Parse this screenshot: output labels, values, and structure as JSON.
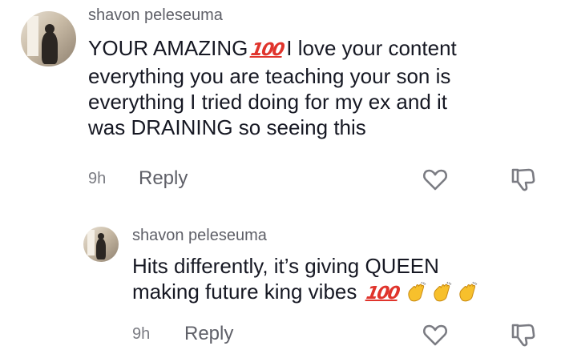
{
  "comment": {
    "username": "shavon peleseuma",
    "lines": [
      "YOUR AMAZING",
      "I love your content",
      "everything you are teaching your son is",
      "everything I tried doing for my ex and it",
      "was DRAINING so seeing this"
    ],
    "emoji_hundred": "100",
    "time": "9h",
    "reply_label": "Reply",
    "icons": [
      "avatar",
      "hundred-points-emoji",
      "heart-icon",
      "thumbs-down-icon"
    ]
  },
  "reply": {
    "username": "shavon peleseuma",
    "lines": [
      "Hits differently, it’s giving QUEEN",
      "making future king vibes"
    ],
    "emoji_hundred": "100",
    "time": "9h",
    "reply_label": "Reply",
    "icons": [
      "avatar",
      "hundred-points-emoji",
      "clapping-hands-icon",
      "clapping-hands-icon",
      "clapping-hands-icon",
      "heart-icon",
      "thumbs-down-icon"
    ]
  },
  "colors": {
    "text": "#161823",
    "muted": "#7a7b82",
    "username": "#5f6068",
    "emoji_red": "#e0342c",
    "clap_yellow": "#f7c02c"
  }
}
